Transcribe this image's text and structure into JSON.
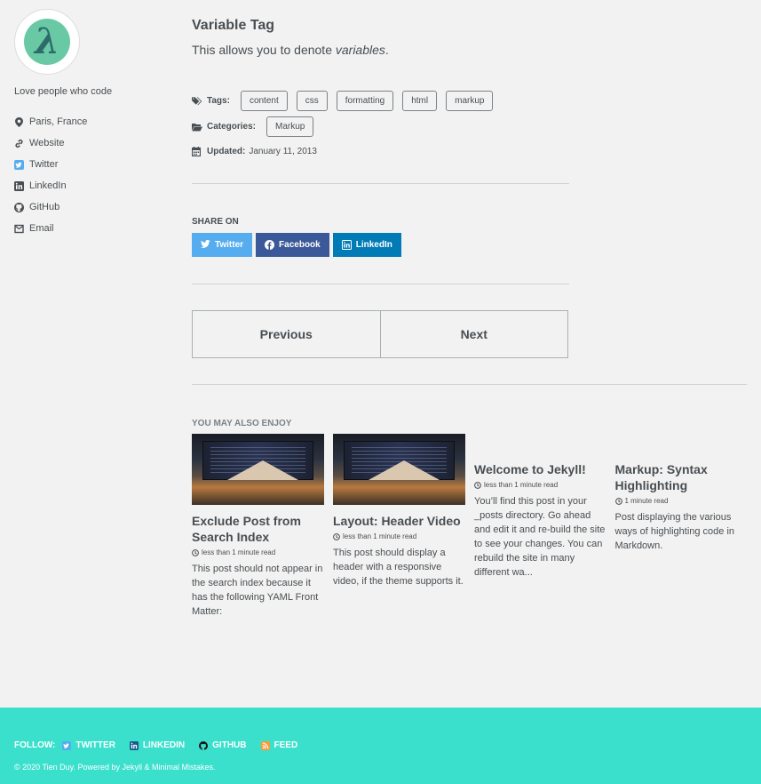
{
  "sidebar": {
    "avatar_letter": "λ",
    "bio": "Love people who code",
    "links": [
      {
        "label": "Paris, France",
        "icon": "map-marker-icon"
      },
      {
        "label": "Website",
        "icon": "link-icon"
      },
      {
        "label": "Twitter",
        "icon": "twitter-icon"
      },
      {
        "label": "LinkedIn",
        "icon": "linkedin-icon"
      },
      {
        "label": "GitHub",
        "icon": "github-icon"
      },
      {
        "label": "Email",
        "icon": "envelope-icon"
      }
    ]
  },
  "post": {
    "title": "Variable Tag",
    "lead_prefix": "This allows you to denote ",
    "lead_em": "variables",
    "lead_suffix": ".",
    "tags_label": "Tags:",
    "tags": [
      "content",
      "css",
      "formatting",
      "html",
      "markup"
    ],
    "categories_label": "Categories:",
    "categories": [
      "Markup"
    ],
    "updated_label": "Updated:",
    "updated_value": "January 11, 2013"
  },
  "share": {
    "title": "SHARE ON",
    "buttons": [
      {
        "label": "Twitter",
        "color": "#55acee",
        "icon": "twitter-icon"
      },
      {
        "label": "Facebook",
        "color": "#3b5998",
        "icon": "facebook-icon"
      },
      {
        "label": "LinkedIn",
        "color": "#007bb6",
        "icon": "linkedin-icon"
      }
    ]
  },
  "pager": {
    "previous": "Previous",
    "next": "Next"
  },
  "related": {
    "title": "YOU MAY ALSO ENJOY",
    "cards": [
      {
        "title": "Exclude Post from Search Index",
        "read": "less than 1 minute read",
        "excerpt": "This post should not appear in the search index because it has the following YAML Front Matter:",
        "has_image": true
      },
      {
        "title": "Layout: Header Video",
        "read": "less than 1 minute read",
        "excerpt": "This post should display a header with a responsive video, if the theme supports it.",
        "has_image": true
      },
      {
        "title": "Welcome to Jekyll!",
        "read": "less than 1 minute read",
        "excerpt": "You’ll find this post in your _posts directory. Go ahead and edit it and re-build the site to see your changes. You can rebuild the site in many different wa...",
        "has_image": false
      },
      {
        "title": "Markup: Syntax Highlighting",
        "read": "1 minute read",
        "excerpt": "Post displaying the various ways of highlighting code in Markdown.",
        "has_image": false
      }
    ]
  },
  "footer": {
    "follow_label": "FOLLOW:",
    "items": [
      {
        "label": "TWITTER",
        "icon": "twitter-icon"
      },
      {
        "label": "LINKEDIN",
        "icon": "linkedin-icon"
      },
      {
        "label": "GITHUB",
        "icon": "github-icon"
      },
      {
        "label": "FEED",
        "icon": "rss-icon"
      }
    ],
    "copyright": "© 2020 Tien Duy. Powered by Jekyll & Minimal Mistakes.",
    "background": "#3be0cd"
  }
}
